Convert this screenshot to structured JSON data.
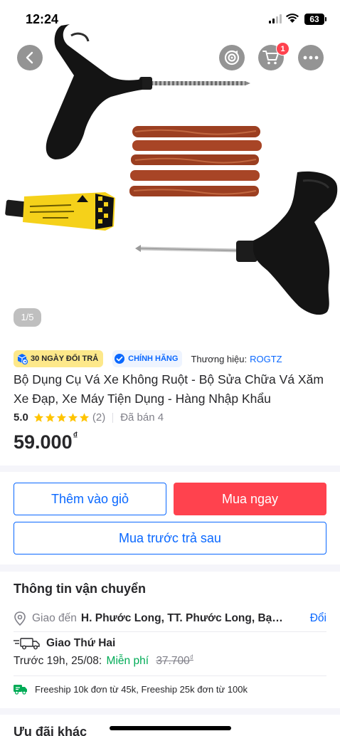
{
  "status_bar": {
    "time": "12:24",
    "battery": "63"
  },
  "header": {
    "back_icon": "chevron-left-icon",
    "spin_icon": "target-icon",
    "cart_icon": "cart-icon",
    "cart_badge": "1",
    "more_icon": "more-horizontal-icon"
  },
  "gallery": {
    "counter": "1/5"
  },
  "product": {
    "return_badge": "30 NGÀY ĐỔI TRẢ",
    "authentic_badge": "CHÍNH HÃNG",
    "brand_label": "Thương hiệu:",
    "brand_name": "ROGTZ",
    "title": "Bộ Dụng Cụ Vá Xe Không Ruột - Bộ Sửa Chữa Vá Xăm Xe Đạp, Xe Máy Tiện Dụng - Hàng Nhập Khẩu",
    "rating_score": "5.0",
    "rating_stars": 5,
    "rating_count": "(2)",
    "sold": "Đã bán 4",
    "price": "59.000",
    "currency": "₫"
  },
  "actions": {
    "add_to_cart": "Thêm vào giỏ",
    "buy_now": "Mua ngay",
    "buy_later": "Mua trước trả sau"
  },
  "shipping": {
    "title": "Thông tin vận chuyển",
    "address_label": "Giao đến",
    "address_value": "H. Phước Long, TT. Phước Long, Bạc Liêu",
    "change_label": "Đổi",
    "delivery_method": "Giao Thứ Hai",
    "eta": "Trước 19h, 25/08:",
    "fee": "Miễn phí",
    "old_fee": "37.700",
    "old_fee_currency": "₫",
    "freeship_note": "Freeship 10k đơn từ 45k, Freeship 25k đơn từ 100k"
  },
  "offers": {
    "title": "Ưu đãi khác"
  },
  "colors": {
    "brand_blue": "#0a68ff",
    "buy_red": "#ff424e",
    "free_green": "#00ab56",
    "star_yellow": "#ffc400"
  }
}
